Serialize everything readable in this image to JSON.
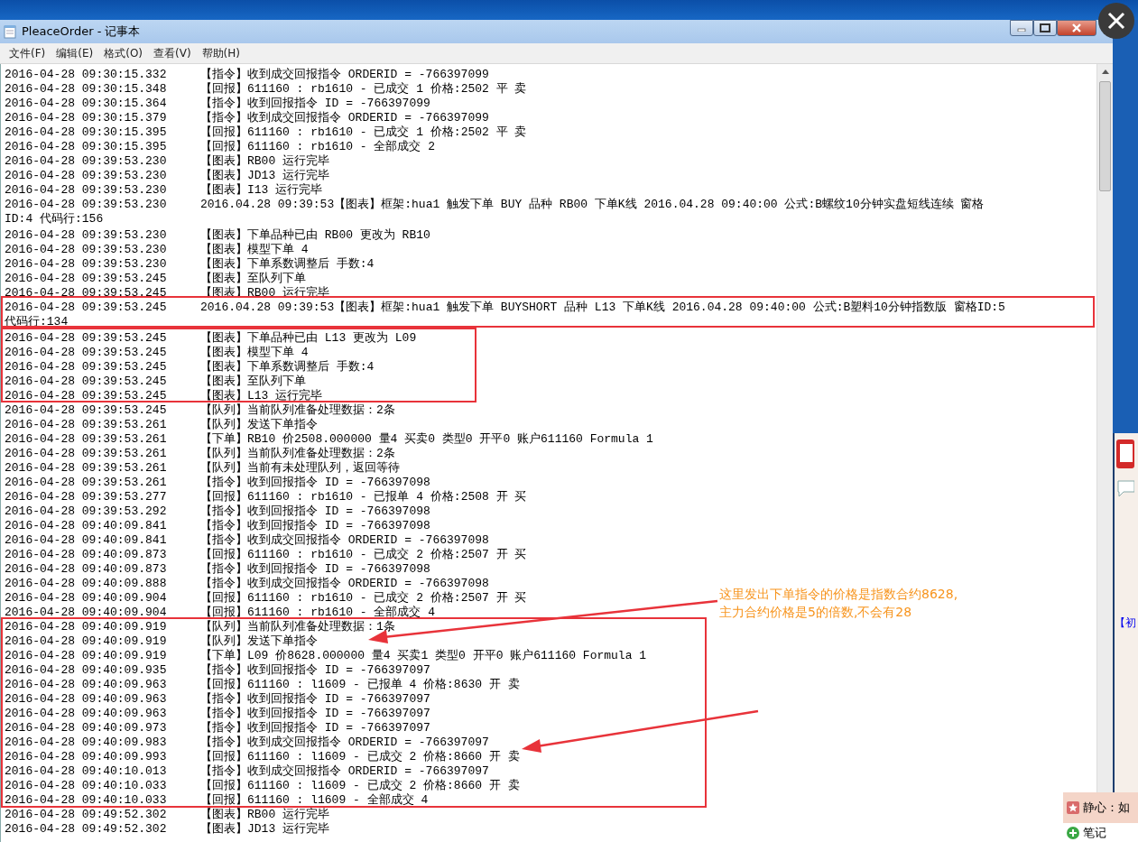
{
  "window": {
    "title": "PleaceOrder - 记事本"
  },
  "menu": [
    "文件(F)",
    "编辑(E)",
    "格式(O)",
    "查看(V)",
    "帮助(H)"
  ],
  "lines": [
    {
      "time": "2016-04-28 09:30:15.332",
      "message": "【指令】收到成交回报指令 ORDERID = -766397099"
    },
    {
      "time": "2016-04-28 09:30:15.348",
      "message": "【回报】611160 : rb1610 - 已成交 1 价格:2502 平 卖"
    },
    {
      "time": "2016-04-28 09:30:15.364",
      "message": "【指令】收到回报指令 ID = -766397099"
    },
    {
      "time": "2016-04-28 09:30:15.379",
      "message": "【指令】收到成交回报指令 ORDERID = -766397099"
    },
    {
      "time": "2016-04-28 09:30:15.395",
      "message": "【回报】611160 : rb1610 - 已成交 1 价格:2502 平 卖"
    },
    {
      "time": "2016-04-28 09:30:15.395",
      "message": "【回报】611160 : rb1610 - 全部成交 2"
    },
    {
      "time": "2016-04-28 09:39:53.230",
      "message": "【图表】RB00 运行完毕"
    },
    {
      "time": "2016-04-28 09:39:53.230",
      "message": "【图表】JD13 运行完毕"
    },
    {
      "time": "2016-04-28 09:39:53.230",
      "message": "【图表】I13 运行完毕"
    },
    {
      "time": "2016-04-28 09:39:53.230",
      "message": "2016.04.28 09:39:53【图表】框架:hua1 触发下单 BUY 品种 RB00 下单K线 2016.04.28 09:40:00 公式:B螺纹10分钟实盘短线连续 窗格",
      "continuation": "ID:4 代码行:156"
    },
    {
      "time": "2016-04-28 09:39:53.230",
      "message": "【图表】下单品种已由 RB00 更改为 RB10"
    },
    {
      "time": "2016-04-28 09:39:53.230",
      "message": "【图表】模型下单 4"
    },
    {
      "time": "2016-04-28 09:39:53.230",
      "message": "【图表】下单系数调整后 手数:4"
    },
    {
      "time": "2016-04-28 09:39:53.245",
      "message": "【图表】至队列下单"
    },
    {
      "time": "2016-04-28 09:39:53.245",
      "message": "【图表】RB00 运行完毕"
    },
    {
      "time": "2016-04-28 09:39:53.245",
      "message": "2016.04.28 09:39:53【图表】框架:hua1 触发下单 BUYSHORT 品种 L13 下单K线 2016.04.28 09:40:00 公式:B塑料10分钟指数版 窗格ID:5",
      "continuation": "代码行:134"
    },
    {
      "time": "2016-04-28 09:39:53.245",
      "message": "【图表】下单品种已由 L13 更改为 L09"
    },
    {
      "time": "2016-04-28 09:39:53.245",
      "message": "【图表】模型下单 4"
    },
    {
      "time": "2016-04-28 09:39:53.245",
      "message": "【图表】下单系数调整后 手数:4"
    },
    {
      "time": "2016-04-28 09:39:53.245",
      "message": "【图表】至队列下单"
    },
    {
      "time": "2016-04-28 09:39:53.245",
      "message": "【图表】L13 运行完毕"
    },
    {
      "time": "2016-04-28 09:39:53.245",
      "message": "【队列】当前队列准备处理数据：2条"
    },
    {
      "time": "2016-04-28 09:39:53.261",
      "message": "【队列】发送下单指令"
    },
    {
      "time": "2016-04-28 09:39:53.261",
      "message": "【下单】RB10 价2508.000000 量4 买卖0 类型0 开平0 账户611160 Formula 1"
    },
    {
      "time": "2016-04-28 09:39:53.261",
      "message": "【队列】当前队列准备处理数据：2条"
    },
    {
      "time": "2016-04-28 09:39:53.261",
      "message": "【队列】当前有未处理队列，返回等待"
    },
    {
      "time": "2016-04-28 09:39:53.261",
      "message": "【指令】收到回报指令 ID = -766397098"
    },
    {
      "time": "2016-04-28 09:39:53.277",
      "message": "【回报】611160 : rb1610 - 已报单 4 价格:2508 开 买"
    },
    {
      "time": "2016-04-28 09:39:53.292",
      "message": "【指令】收到回报指令 ID = -766397098"
    },
    {
      "time": "2016-04-28 09:40:09.841",
      "message": "【指令】收到回报指令 ID = -766397098"
    },
    {
      "time": "2016-04-28 09:40:09.841",
      "message": "【指令】收到成交回报指令 ORDERID = -766397098"
    },
    {
      "time": "2016-04-28 09:40:09.873",
      "message": "【回报】611160 : rb1610 - 已成交 2 价格:2507 开 买"
    },
    {
      "time": "2016-04-28 09:40:09.873",
      "message": "【指令】收到回报指令 ID = -766397098"
    },
    {
      "time": "2016-04-28 09:40:09.888",
      "message": "【指令】收到成交回报指令 ORDERID = -766397098"
    },
    {
      "time": "2016-04-28 09:40:09.904",
      "message": "【回报】611160 : rb1610 - 已成交 2 价格:2507 开 买"
    },
    {
      "time": "2016-04-28 09:40:09.904",
      "message": "【回报】611160 : rb1610 - 全部成交 4"
    },
    {
      "time": "2016-04-28 09:40:09.919",
      "message": "【队列】当前队列准备处理数据：1条"
    },
    {
      "time": "2016-04-28 09:40:09.919",
      "message": "【队列】发送下单指令"
    },
    {
      "time": "2016-04-28 09:40:09.919",
      "message": "【下单】L09 价8628.000000 量4 买卖1 类型0 开平0 账户611160 Formula 1"
    },
    {
      "time": "2016-04-28 09:40:09.935",
      "message": "【指令】收到回报指令 ID = -766397097"
    },
    {
      "time": "2016-04-28 09:40:09.963",
      "message": "【回报】611160 : l1609 - 已报单 4 价格:8630 开 卖"
    },
    {
      "time": "2016-04-28 09:40:09.963",
      "message": "【指令】收到回报指令 ID = -766397097"
    },
    {
      "time": "2016-04-28 09:40:09.963",
      "message": "【指令】收到回报指令 ID = -766397097"
    },
    {
      "time": "2016-04-28 09:40:09.973",
      "message": "【指令】收到回报指令 ID = -766397097"
    },
    {
      "time": "2016-04-28 09:40:09.983",
      "message": "【指令】收到成交回报指令 ORDERID = -766397097"
    },
    {
      "time": "2016-04-28 09:40:09.993",
      "message": "【回报】611160 : l1609 - 已成交 2 价格:8660 开 卖"
    },
    {
      "time": "2016-04-28 09:40:10.013",
      "message": "【指令】收到成交回报指令 ORDERID = -766397097"
    },
    {
      "time": "2016-04-28 09:40:10.033",
      "message": "【回报】611160 : l1609 - 已成交 2 价格:8660 开 卖"
    },
    {
      "time": "2016-04-28 09:40:10.033",
      "message": "【回报】611160 : l1609 - 全部成交 4"
    },
    {
      "time": "2016-04-28 09:49:52.302",
      "message": "【图表】RB00 运行完毕"
    },
    {
      "time": "2016-04-28 09:49:52.302",
      "message": "【图表】JD13 运行完毕"
    }
  ],
  "annotation": [
    "这里发出下单指令的价格是指数合约8628,",
    "主力合约价格是5的倍数,不会有28"
  ],
  "side_panel": {
    "link": "【初",
    "popup": "静心：如",
    "note": "笔记"
  }
}
